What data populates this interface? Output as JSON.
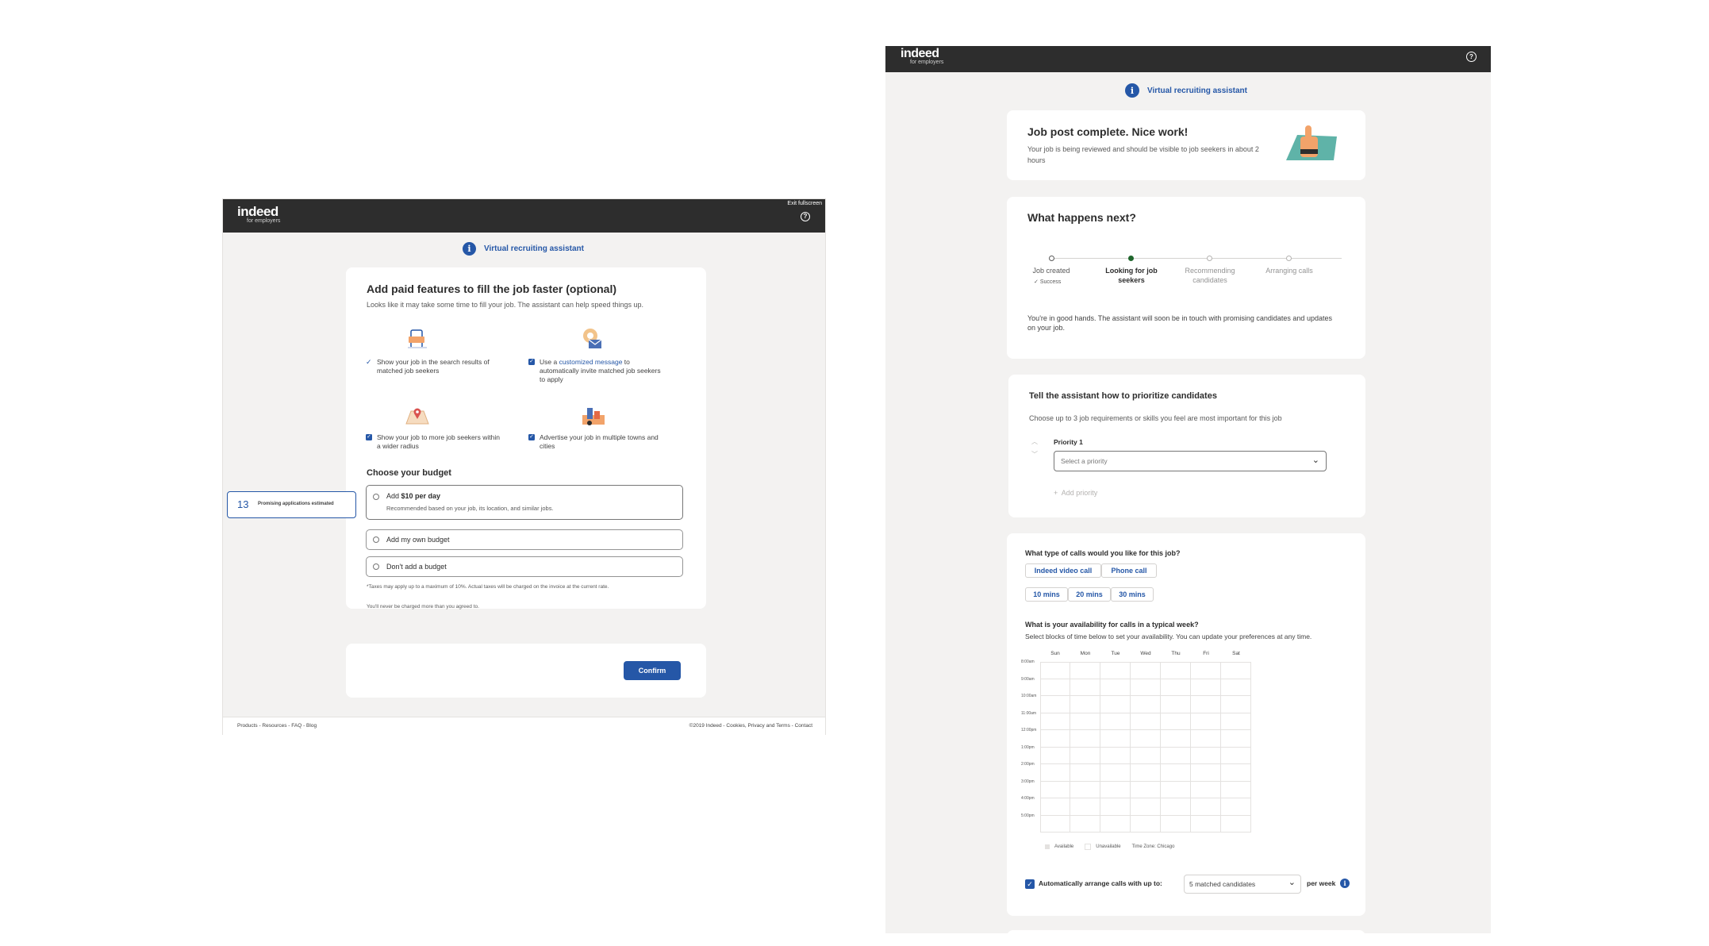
{
  "left": {
    "brand": {
      "name": "indeed",
      "sub": "for employers"
    },
    "exit_fullscreen": "Exit fullscreen",
    "assistant_label": "Virtual recruiting assistant",
    "title": "Add paid features to fill the job faster (optional)",
    "subtitle": "Looks like it may take some time to fill your job. The assistant can help speed things up.",
    "features": [
      {
        "text": "Show your job in the search results of matched job seekers",
        "checked": true
      },
      {
        "text_pre": "Use a ",
        "link": "customized message",
        "text_post": " to automatically invite matched job seekers to apply",
        "checked": true
      },
      {
        "text": "Show your job to more job seekers within a wider radius",
        "checked": true
      },
      {
        "text": "Advertise your job in multiple towns and cities",
        "checked": true
      }
    ],
    "budget_heading": "Choose your budget",
    "estimate": {
      "count": "13",
      "label": "Promising applications estimated"
    },
    "budget_options": [
      {
        "label_pre": "Add ",
        "label_bold": "$10 per day",
        "description": "Recommended based on your job, its location, and similar jobs."
      },
      {
        "label": "Add my own budget"
      },
      {
        "label": "Don't add a budget"
      }
    ],
    "tax_note": "*Taxes may apply up to a maximum of 10%. Actual taxes will be charged on the invoice at the current rate.",
    "charge_note": "You'll never be charged more than you agreed to.",
    "confirm_label": "Confirm",
    "footer_left": "Products - Resources - FAQ - Blog",
    "footer_right": "©2019 Indeed - Cookies, Privacy and Terms - Contact"
  },
  "right": {
    "brand": {
      "name": "indeed",
      "sub": "for employers"
    },
    "assistant_label": "Virtual recruiting assistant",
    "complete": {
      "title": "Job post complete. Nice work!",
      "text": "Your job is being reviewed and should be visible to job seekers in about 2 hours"
    },
    "next": {
      "title": "What happens next?",
      "steps": [
        {
          "label": "Job created",
          "sub": "Success",
          "state": "done"
        },
        {
          "label": "Looking for job seekers",
          "state": "current"
        },
        {
          "label": "Recommending candidates",
          "state": "todo"
        },
        {
          "label": "Arranging calls",
          "state": "todo"
        }
      ],
      "text": "You're in good hands. The assistant will soon be in touch with promising candidates and updates on your job."
    },
    "priority": {
      "title": "Tell the assistant how to prioritize candidates",
      "subtitle": "Choose up to 3 job requirements or skills you feel are most important for this job",
      "field_label": "Priority 1",
      "placeholder": "Select a priority",
      "add_label": "Add priority"
    },
    "calls": {
      "type_question": "What type of calls would you like for this job?",
      "types": [
        "Indeed video call",
        "Phone call"
      ],
      "durations": [
        "10 mins",
        "20 mins",
        "30 mins"
      ],
      "availability_title": "What is your availability for calls in a typical week?",
      "availability_sub": "Select blocks of time below to set your availability. You can update your preferences at any time.",
      "days": [
        "Sun",
        "Mon",
        "Tue",
        "Wed",
        "Thu",
        "Fri",
        "Sat"
      ],
      "times": [
        "8:00am",
        "9:00am",
        "10:00am",
        "11:00am",
        "12:00pm",
        "1:00pm",
        "2:00pm",
        "3:00pm",
        "4:00pm",
        "5:00pm"
      ],
      "legend": [
        "Available",
        "Unavailable",
        "Time Zone: Chicago"
      ],
      "auto_label": "Automatically arrange calls with up to:",
      "auto_value": "5 matched candidates",
      "per_week": "per week"
    }
  }
}
